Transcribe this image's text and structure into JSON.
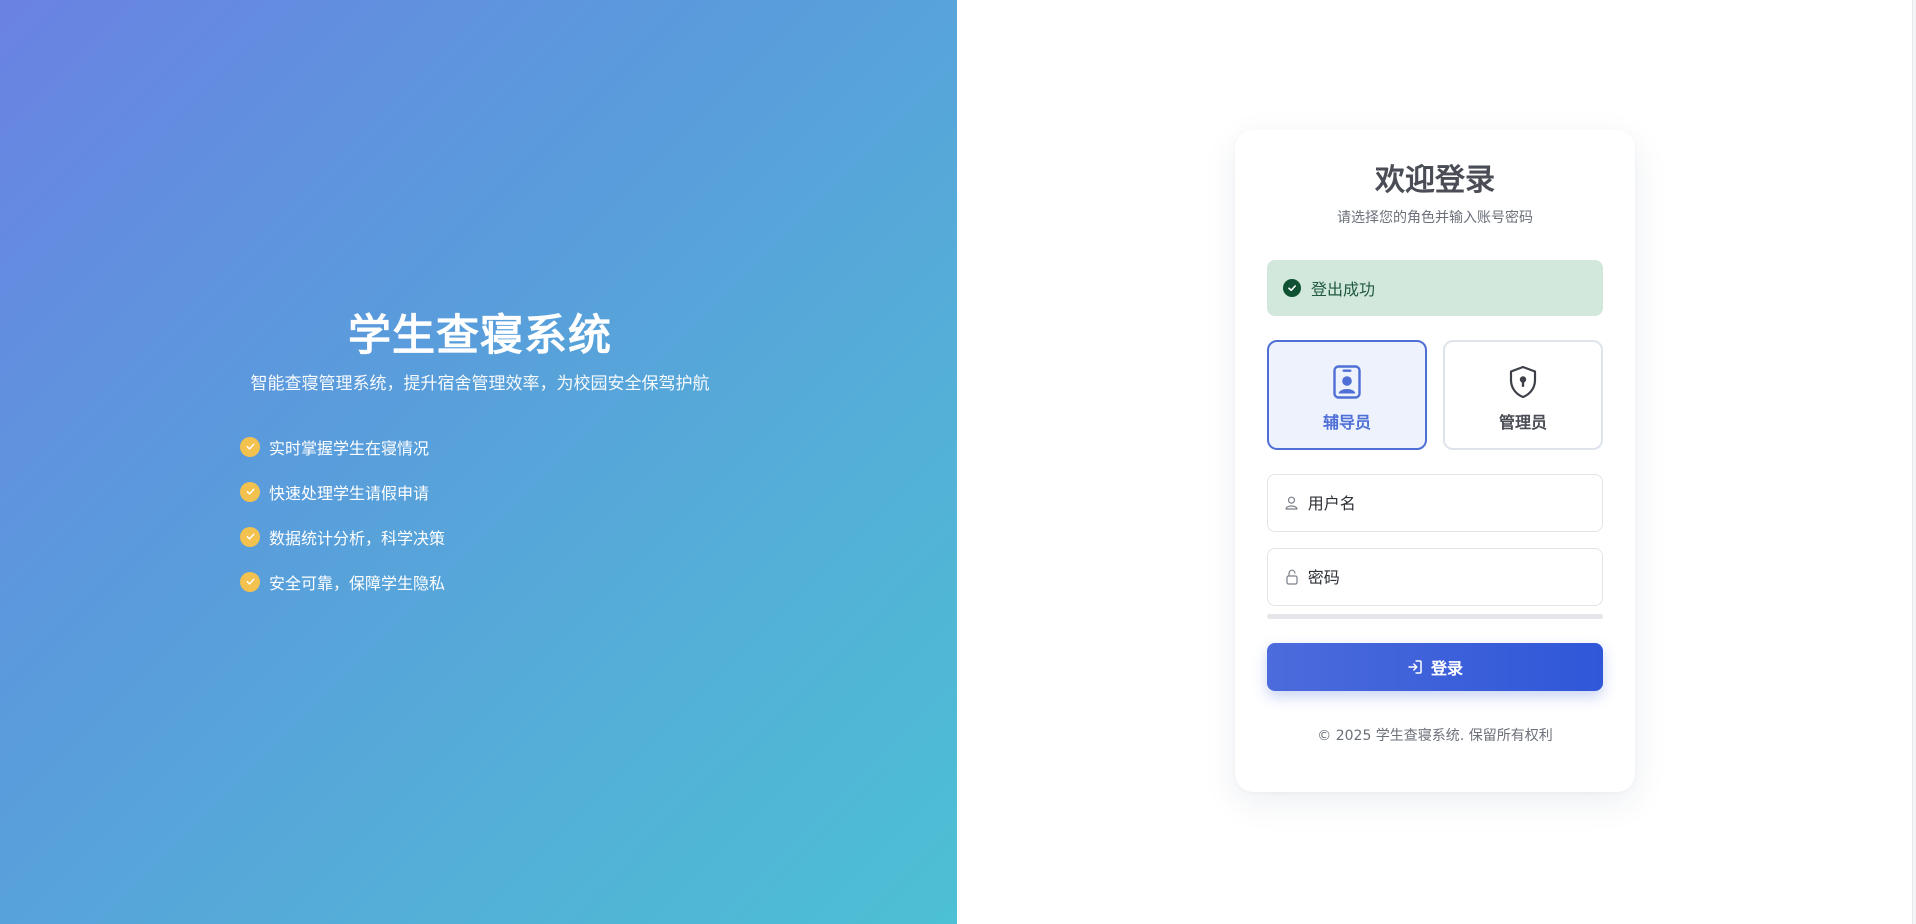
{
  "hero": {
    "title": "学生查寝系统",
    "subtitle": "智能查寝管理系统，提升宿舍管理效率，为校园安全保驾护航",
    "features": [
      "实时掌握学生在寝情况",
      "快速处理学生请假申请",
      "数据统计分析，科学决策",
      "安全可靠，保障学生隐私"
    ],
    "feature_icon": "check-circle-icon"
  },
  "login": {
    "title": "欢迎登录",
    "subtitle": "请选择您的角色并输入账号密码",
    "alert": {
      "text": "登出成功",
      "icon": "check-circle-icon"
    },
    "roles": [
      {
        "label": "辅导员",
        "icon": "id-badge-icon",
        "selected": true
      },
      {
        "label": "管理员",
        "icon": "shield-keyhole-icon",
        "selected": false
      }
    ],
    "username": {
      "placeholder": "用户名",
      "value": "",
      "icon": "user-icon"
    },
    "password": {
      "placeholder": "密码",
      "value": "",
      "icon": "lock-icon"
    },
    "submit": {
      "label": "登录",
      "icon": "sign-in-icon"
    },
    "footer": "© 2025 学生查寝系统. 保留所有权利"
  },
  "colors": {
    "hero_gradient_start": "#6a82e2",
    "hero_gradient_end": "#4cc0d4",
    "accent": "#4f6fd6",
    "check_yellow": "#f2c14e",
    "alert_bg": "#d2e8dc",
    "alert_icon": "#0f5132",
    "button_start": "#4c6bdc",
    "button_end": "#2f57d8"
  }
}
